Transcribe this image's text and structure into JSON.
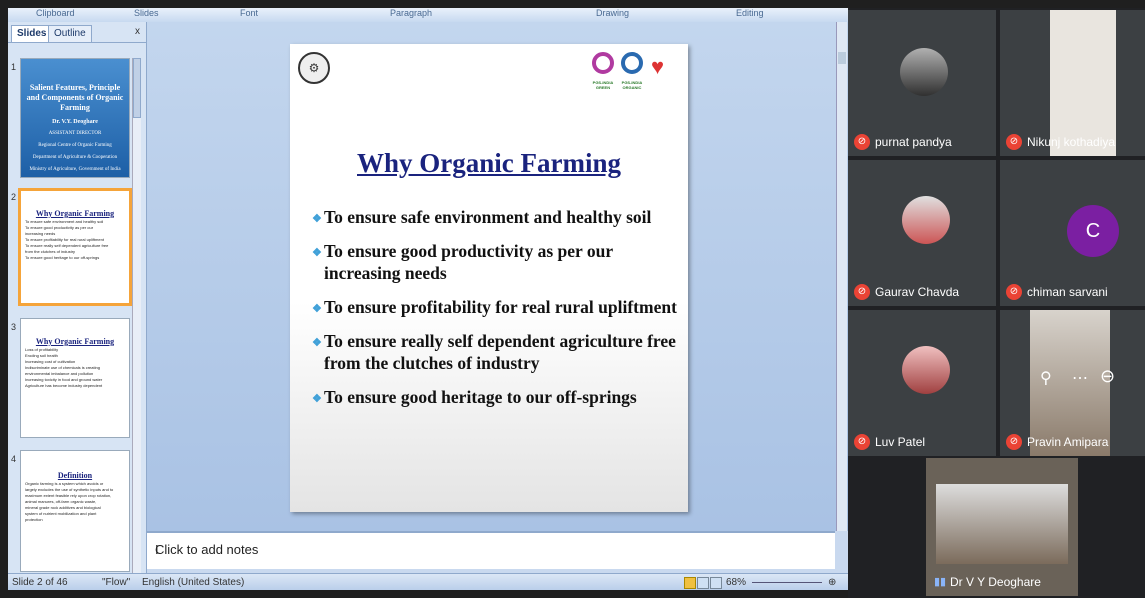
{
  "ribbon": {
    "groups": [
      "Clipboard",
      "Slides",
      "Font",
      "Paragraph",
      "Drawing",
      "Editing"
    ]
  },
  "panel": {
    "tabs": [
      "Slides",
      "Outline"
    ],
    "close": "x",
    "slides": [
      {
        "num": "1",
        "title": "Salient Features, Principle and Components of Organic Farming",
        "author": "Dr. V.Y. Deoghare",
        "lines": [
          "ASSISTANT DIRECTOR",
          "Regional Centre of Organic Farming",
          "Department of Agriculture & Cooperation",
          "Ministry of Agriculture, Government of India"
        ]
      },
      {
        "num": "2",
        "title": "Why Organic Farming",
        "lines": [
          "To ensure safe environment and healthy soil",
          "To ensure good productivity as per our",
          "increasing needs",
          "To ensure profitability for real rural upliftment",
          "To ensure really self dependent agriculture free",
          "from the clutches of industry",
          "To ensure good heritage to our off-springs"
        ]
      },
      {
        "num": "3",
        "title": "Why Organic Farming",
        "lines": [
          "Loss of profitability",
          "Eroding soil health",
          "Increasing cost of cultivation",
          "Indiscriminate use of chemicals is creating",
          "environmental imbalance and pollution",
          "Increasing toxicity in food and ground water",
          "Agriculture has become industry dependent"
        ]
      },
      {
        "num": "4",
        "title": "Definition",
        "lines": [
          "Organic farming is a system which avoids or",
          "largely excludes the use of synthetic inputs and to",
          "maximum extent feasible rely upon crop rotation,",
          "animal manures, off-farm organic waste,",
          "mineral grade rock additives and biological",
          "system of nutrient mobilization and plant",
          "protection"
        ]
      }
    ]
  },
  "slide": {
    "title": "Why Organic Farming",
    "logos": [
      {
        "label": "PGS-INDIA GREEN"
      },
      {
        "label": "PGS-INDIA ORGANIC"
      },
      {
        "label": ""
      }
    ],
    "bullets": [
      [
        "To ensure safe environment and healthy soil"
      ],
      [
        "To ensure good productivity as per our",
        "increasing needs"
      ],
      [
        "To ensure profitability for real rural upliftment"
      ],
      [
        "To ensure really self dependent agriculture free",
        "from the clutches of industry"
      ],
      [
        "To ensure good heritage to our off-springs"
      ]
    ]
  },
  "notes": {
    "placeholder": "Click to add notes"
  },
  "status": {
    "slide_info": "Slide 2 of 46",
    "theme": "\"Flow\"",
    "language": "English (United States)",
    "zoom": "68%"
  },
  "meet": {
    "participants": [
      {
        "name": "purnat pandya",
        "muted": true
      },
      {
        "name": "Nikunj kothadiya",
        "muted": true
      },
      {
        "name": "Gaurav Chavda",
        "muted": true
      },
      {
        "name": "chiman sarvani",
        "muted": true,
        "initial": "C"
      },
      {
        "name": "Luv Patel",
        "muted": true
      },
      {
        "name": "Pravin Amipara",
        "muted": true
      },
      {
        "name": "Dr V Y Deoghare",
        "muted": false
      }
    ]
  },
  "colors": {
    "title": "#1a237e",
    "bullet": "#3fa0d8",
    "mute": "#ea4335",
    "avatar_c": "#7b1fa2",
    "selected_thumb": "#f5a43a"
  }
}
